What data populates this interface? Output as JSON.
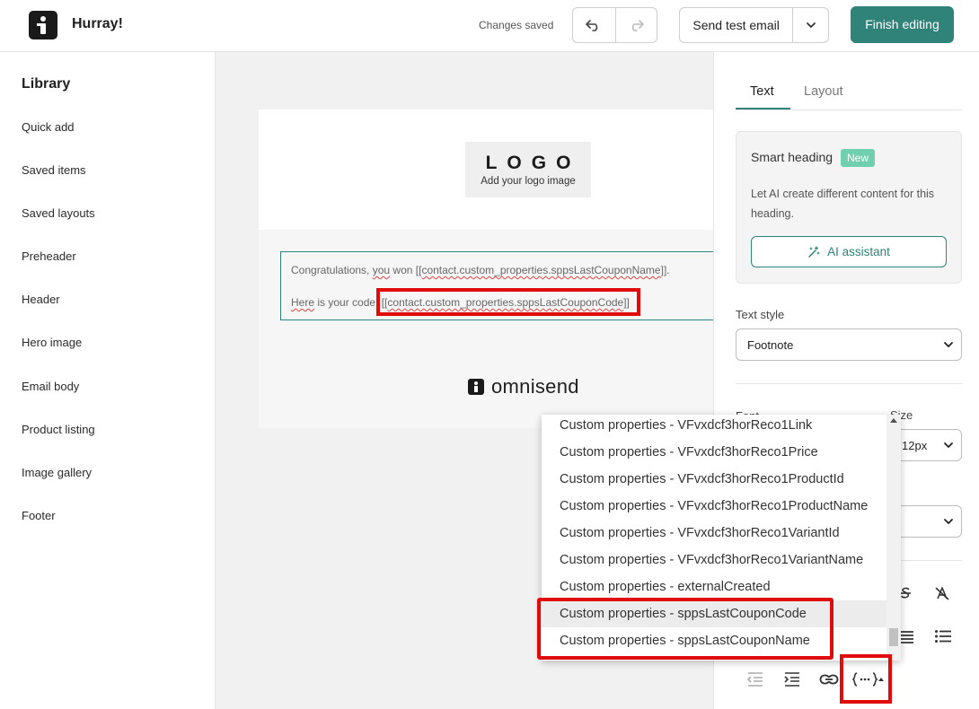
{
  "topbar": {
    "app_title": "Hurray!",
    "status": "Changes saved",
    "send_test_label": "Send test email",
    "finish_label": "Finish editing",
    "colors": {
      "accent": "#2f8378"
    }
  },
  "sidebar": {
    "title": "Library",
    "items": [
      {
        "label": "Quick add"
      },
      {
        "label": "Saved items"
      },
      {
        "label": "Saved layouts"
      },
      {
        "label": "Preheader"
      },
      {
        "label": "Header"
      },
      {
        "label": "Hero image"
      },
      {
        "label": "Email body"
      },
      {
        "label": "Product listing"
      },
      {
        "label": "Image gallery"
      },
      {
        "label": "Footer"
      }
    ]
  },
  "canvas": {
    "logo_text": "LOGO",
    "logo_sub": "Add your logo image",
    "line1_prefix": "Congratulations, ",
    "line1_word": "you",
    "line1_middle": " won [[",
    "line1_token": "contact.custom_properties.sppsLastCouponName",
    "line1_suffix": "]].",
    "line2_word1": "Here",
    "line2_middle": " is your code: ",
    "line2_token_open": "[[",
    "line2_token": "contact.custom_properties.sppsLastCouponCode",
    "line2_token_close": "]]",
    "footer_brand": "omnisend"
  },
  "panel": {
    "tabs": [
      {
        "label": "Text"
      },
      {
        "label": "Layout"
      }
    ],
    "smart_heading": {
      "title": "Smart heading",
      "badge": "New",
      "description": "Let AI create different content for this heading.",
      "ai_button": "AI assistant"
    },
    "text_style": {
      "label": "Text style",
      "value": "Footnote"
    },
    "font": {
      "label": "Font"
    },
    "size": {
      "label": "Size",
      "value": "12px"
    }
  },
  "dropdown": {
    "items": [
      {
        "label": "Custom properties - VFvxdcf3horReco1Link"
      },
      {
        "label": "Custom properties - VFvxdcf3horReco1Price"
      },
      {
        "label": "Custom properties - VFvxdcf3horReco1ProductId"
      },
      {
        "label": "Custom properties - VFvxdcf3horReco1ProductName"
      },
      {
        "label": "Custom properties - VFvxdcf3horReco1VariantId"
      },
      {
        "label": "Custom properties - VFvxdcf3horReco1VariantName"
      },
      {
        "label": "Custom properties - externalCreated"
      },
      {
        "label": "Custom properties - sppsLastCouponCode"
      },
      {
        "label": "Custom properties - sppsLastCouponName"
      }
    ]
  }
}
